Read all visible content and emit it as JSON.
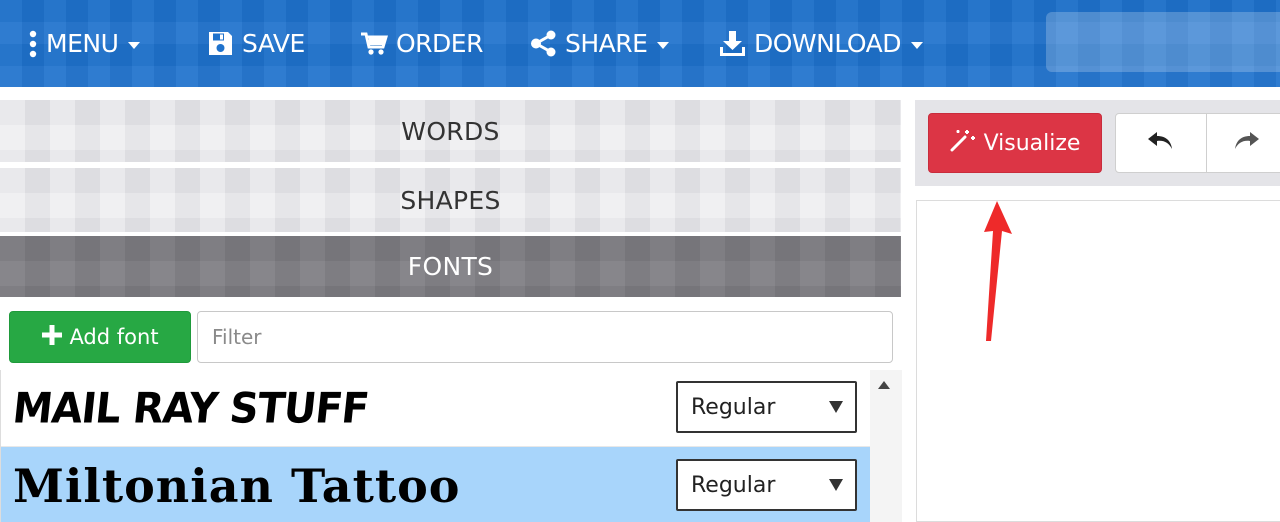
{
  "topbar": {
    "menu_label": "MENU",
    "save_label": "SAVE",
    "order_label": "ORDER",
    "share_label": "SHARE",
    "download_label": "DOWNLOAD"
  },
  "panels": {
    "words": "WORDS",
    "shapes": "SHAPES",
    "fonts": "FONTS"
  },
  "fonts_panel": {
    "add_font_label": "Add font",
    "filter_placeholder": "Filter",
    "rows": [
      {
        "sample": "MAIL RAY STUFF",
        "style": "Regular",
        "selected": false
      },
      {
        "sample": "Miltonian Tattoo",
        "style": "Regular",
        "selected": true
      }
    ]
  },
  "right": {
    "visualize_label": "Visualize"
  },
  "colors": {
    "topbar": "#1f72cc",
    "add_font": "#27a844",
    "visualize": "#dc3545",
    "selected_row": "#a8d5fb",
    "annotation_arrow": "#ee2a2a"
  },
  "icons": {
    "menu": "vertical-dots-icon",
    "save": "floppy-disk-icon",
    "order": "shopping-cart-icon",
    "share": "share-nodes-icon",
    "download": "download-icon",
    "add": "plus-icon",
    "visualize": "magic-wand-icon",
    "undo": "undo-arrow-icon",
    "redo": "redo-arrow-icon"
  }
}
